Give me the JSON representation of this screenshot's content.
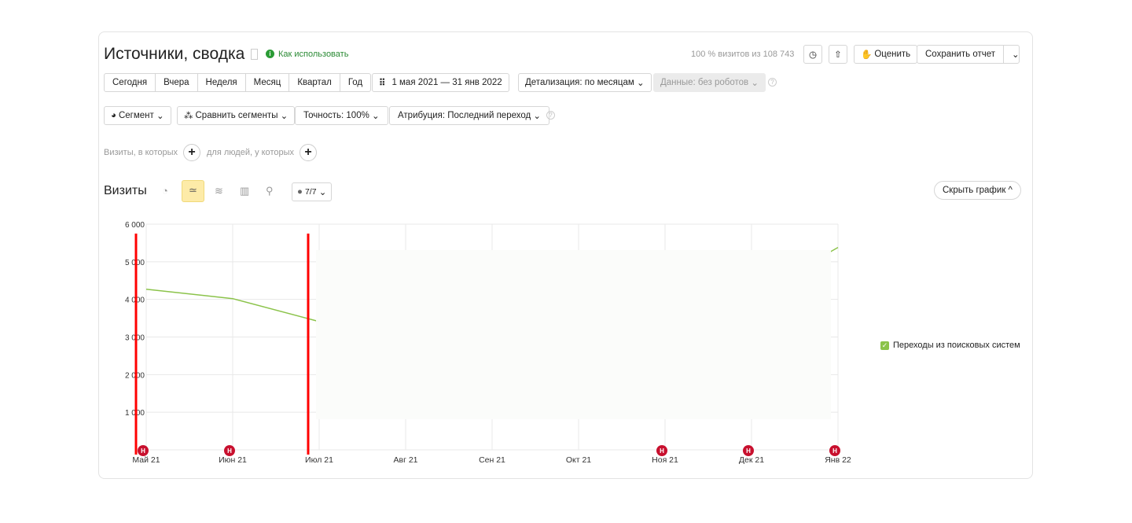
{
  "header": {
    "title": "Источники, сводка",
    "help_link": "Как использовать",
    "visits_info": "100 % визитов из 108 743",
    "rate_label": "Оценить",
    "save_label": "Сохранить отчет"
  },
  "periods": [
    "Сегодня",
    "Вчера",
    "Неделя",
    "Месяц",
    "Квартал",
    "Год"
  ],
  "date_range": "1 мая 2021 — 31 янв 2022",
  "detail": "Детализация: по месяцам",
  "data_filter": "Данные: без роботов",
  "segment": "Сегмент",
  "compare": "Сравнить сегменты",
  "accuracy": "Точность: 100%",
  "attribution": "Атрибуция: Последний переход",
  "filters": {
    "visits": "Визиты, в которых",
    "people": "для людей, у которых"
  },
  "chart_header": {
    "title": "Визиты",
    "notes": "7/7",
    "hide": "Скрыть график"
  },
  "legend": {
    "label": "Переходы из поисковых систем",
    "color": "#8bc34a",
    "checked": true
  },
  "chart_data": {
    "type": "line",
    "categories": [
      "Май 21",
      "Июн 21",
      "Июл 21",
      "Авг 21",
      "Сен 21",
      "Окт 21",
      "Ноя 21",
      "Дек 21",
      "Янв 22"
    ],
    "yticks": [
      "0",
      "1 000",
      "2 000",
      "3 000",
      "4 000",
      "5 000",
      "6 000"
    ],
    "ylim": [
      0,
      6000
    ],
    "grid": true,
    "series": [
      {
        "name": "Переходы из поисковых систем",
        "values": [
          4270,
          4020,
          3410,
          null,
          null,
          null,
          null,
          null,
          5380
        ]
      }
    ],
    "annotation_months": [
      "Май 21",
      "Июн 21",
      "Ноя 21",
      "Дек 21",
      "Янв 22"
    ],
    "annotation_label": "Н"
  }
}
